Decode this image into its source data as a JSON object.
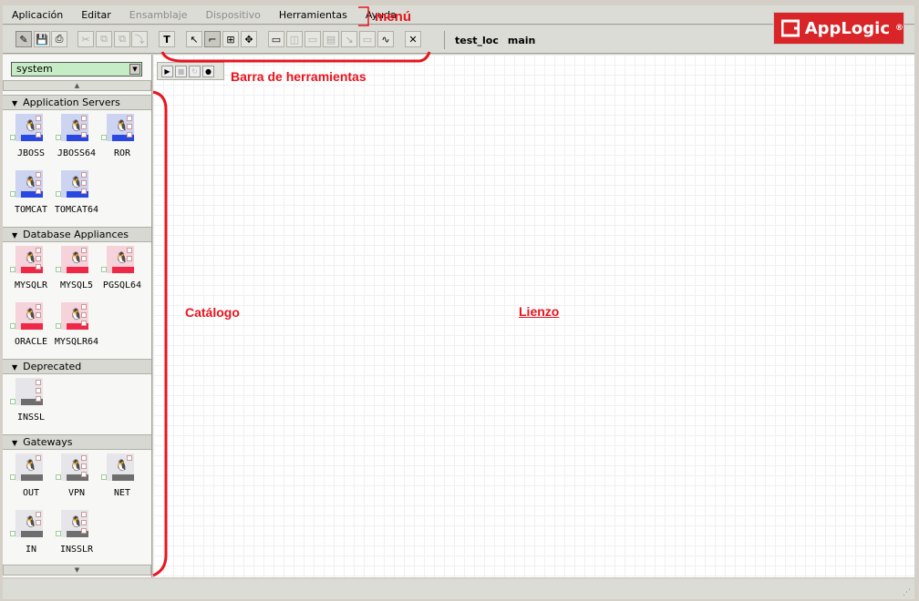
{
  "menu": [
    "Aplicación",
    "Editar",
    "Ensamblaje",
    "Dispositivo",
    "Herramientas",
    "Ayuda"
  ],
  "menu_disabled": [
    false,
    false,
    true,
    true,
    false,
    false
  ],
  "toolbar": {
    "buttons": [
      {
        "name": "edit-pencil",
        "glyph": "✎",
        "dis": false,
        "act": true
      },
      {
        "name": "save",
        "glyph": "💾",
        "dis": false
      },
      {
        "name": "print",
        "glyph": "⎙",
        "dis": false
      },
      {
        "name": "cut",
        "glyph": "✂",
        "dis": true
      },
      {
        "name": "copy",
        "glyph": "⧉",
        "dis": true
      },
      {
        "name": "paste",
        "glyph": "⧉",
        "dis": true
      },
      {
        "name": "paste-into",
        "glyph": "⤵",
        "dis": true
      },
      {
        "name": "text",
        "glyph": "T",
        "dis": false
      },
      {
        "name": "select",
        "glyph": "↖",
        "dis": false
      },
      {
        "name": "connect",
        "glyph": "⌐",
        "dis": false,
        "act": true
      },
      {
        "name": "layout",
        "glyph": "⊞",
        "dis": false
      },
      {
        "name": "move",
        "glyph": "✥",
        "dis": false
      },
      {
        "name": "window",
        "glyph": "▭",
        "dis": false
      },
      {
        "name": "subassembly",
        "glyph": "◫",
        "dis": true
      },
      {
        "name": "chart",
        "glyph": "▭",
        "dis": true
      },
      {
        "name": "table",
        "glyph": "▤",
        "dis": true
      },
      {
        "name": "pointer-box",
        "glyph": "↘",
        "dis": true
      },
      {
        "name": "new-box",
        "glyph": "▭",
        "dis": true
      },
      {
        "name": "monitor",
        "glyph": "∿",
        "dis": false
      },
      {
        "name": "close",
        "glyph": "✕",
        "dis": false
      }
    ]
  },
  "location": {
    "app": "test_loc",
    "package": "main"
  },
  "logo": {
    "text": "AppLogic",
    "mark": "®"
  },
  "catalog": {
    "selected": "system",
    "categories": [
      {
        "name": "Application Servers",
        "theme": "blue",
        "items": [
          {
            "label": "JBOSS",
            "ports": 3
          },
          {
            "label": "JBOSS64",
            "ports": 3
          },
          {
            "label": "ROR",
            "ports": 3
          },
          {
            "label": "TOMCAT",
            "ports": 3
          },
          {
            "label": "TOMCAT64",
            "ports": 3
          }
        ]
      },
      {
        "name": "Database Appliances",
        "theme": "red",
        "items": [
          {
            "label": "MYSQLR",
            "ports": 3
          },
          {
            "label": "MYSQL5",
            "ports": 2
          },
          {
            "label": "PGSQL64",
            "ports": 2
          },
          {
            "label": "ORACLE",
            "ports": 2
          },
          {
            "label": "MYSQLR64",
            "ports": 3
          }
        ]
      },
      {
        "name": "Deprecated",
        "theme": "gray",
        "items": [
          {
            "label": "INSSL",
            "ports": 3,
            "nopeng": true
          }
        ]
      },
      {
        "name": "Gateways",
        "theme": "gray",
        "items": [
          {
            "label": "OUT",
            "ports": 1
          },
          {
            "label": "VPN",
            "ports": 3
          },
          {
            "label": "NET",
            "ports": 1
          },
          {
            "label": "IN",
            "ports": 2
          },
          {
            "label": "INSSLR",
            "ports": 3
          }
        ]
      }
    ]
  },
  "themes": {
    "blue": {
      "bg": "#ccd4f2",
      "bar": "#2848e0"
    },
    "red": {
      "bg": "#f6d2da",
      "bar": "#f02848"
    },
    "gray": {
      "bg": "#e6e6ea",
      "bar": "#6e6e6e"
    }
  },
  "annotations": {
    "menu": "menú",
    "toolbar": "Barra de herramientas",
    "catalog": "Catálogo",
    "canvas": "Lienzo"
  }
}
